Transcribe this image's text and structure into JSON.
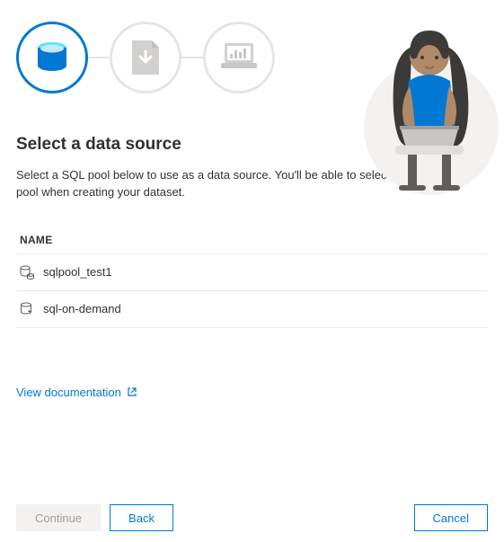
{
  "heading": "Select a data source",
  "description": "Select a SQL pool below to use as a data source. You'll be able to select tables from this pool when creating your dataset.",
  "table": {
    "column_header": "NAME",
    "rows": [
      {
        "name": "sqlpool_test1"
      },
      {
        "name": "sql-on-demand"
      }
    ]
  },
  "documentation_link": "View documentation",
  "buttons": {
    "continue": "Continue",
    "back": "Back",
    "cancel": "Cancel"
  }
}
